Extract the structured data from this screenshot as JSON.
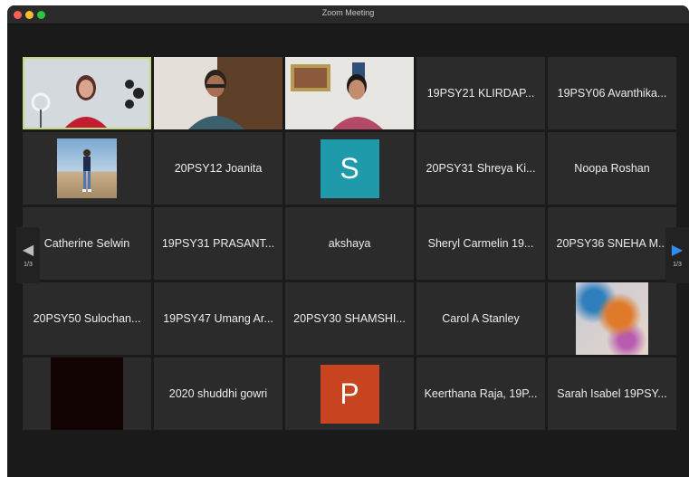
{
  "window": {
    "title": "Zoom Meeting"
  },
  "tiles": [
    {
      "type": "video"
    },
    {
      "type": "video"
    },
    {
      "type": "video"
    },
    {
      "type": "name",
      "label": "19PSY21 KLIRDAP..."
    },
    {
      "type": "name",
      "label": "19PSY06 Avanthika..."
    },
    {
      "type": "picture"
    },
    {
      "type": "name",
      "label": "20PSY12 Joanita"
    },
    {
      "type": "avatar",
      "letter": "S",
      "color": "#1f9aab"
    },
    {
      "type": "name",
      "label": "20PSY31 Shreya Ki..."
    },
    {
      "type": "name",
      "label": "Noopa Roshan"
    },
    {
      "type": "name",
      "label": "Catherine Selwin"
    },
    {
      "type": "name",
      "label": "19PSY31 PRASANT..."
    },
    {
      "type": "name",
      "label": "akshaya"
    },
    {
      "type": "name",
      "label": "Sheryl Carmelin 19..."
    },
    {
      "type": "name",
      "label": "20PSY36 SNEHA M..."
    },
    {
      "type": "name",
      "label": "20PSY50 Sulochan..."
    },
    {
      "type": "name",
      "label": "19PSY47 Umang Ar..."
    },
    {
      "type": "name",
      "label": "20PSY30 SHAMSHI..."
    },
    {
      "type": "name",
      "label": "Carol A Stanley"
    },
    {
      "type": "picture"
    },
    {
      "type": "picture"
    },
    {
      "type": "name",
      "label": "2020 shuddhi gowri"
    },
    {
      "type": "avatar",
      "letter": "P",
      "color": "#c8431f"
    },
    {
      "type": "name",
      "label": "Keerthana Raja, 19P..."
    },
    {
      "type": "name",
      "label": "Sarah Isabel 19PSY..."
    }
  ],
  "navigation": {
    "prev_icon": "left-arrow-icon",
    "next_icon": "right-arrow-icon",
    "page_left": "1/3",
    "page_right": "1/3"
  },
  "colors": {
    "active_speaker_border": "#c6d682",
    "next_arrow": "#2d8cf0"
  }
}
